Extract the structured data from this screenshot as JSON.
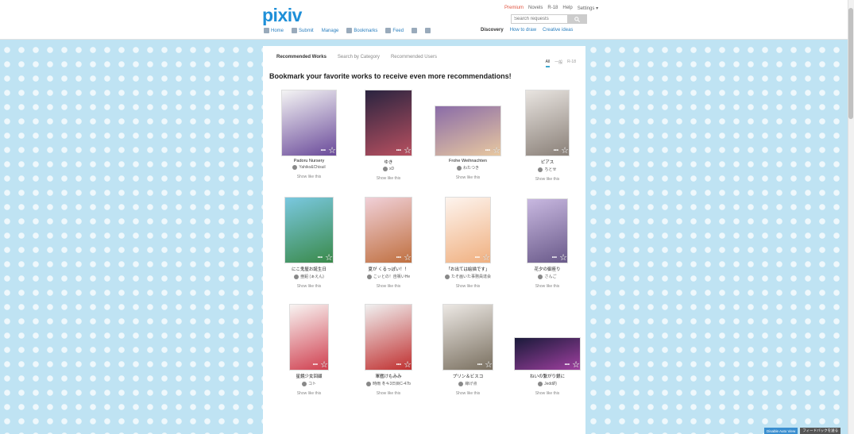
{
  "header": {
    "logo": "pixiv",
    "top_links": [
      "Premium",
      "Novels",
      "R-18",
      "Help",
      "Settings ▾"
    ],
    "search_placeholder": "Search requests",
    "nav": [
      "Home",
      "Submit",
      "Manage",
      "Bookmarks",
      "Feed"
    ],
    "nav_right": [
      "Discovery",
      "How to draw",
      "Creative ideas"
    ]
  },
  "tabs": [
    "Recommended Works",
    "Search by Category",
    "Recommended Users"
  ],
  "filters": [
    "All",
    "一般",
    "R-18"
  ],
  "heading": "Bookmark your favorite works to receive even more recommendations!",
  "more_label": "Show like this",
  "works": [
    {
      "title": "Padoru Nursery",
      "author": "Yahiko&Chisuil",
      "colors": [
        "#f4f4f4",
        "#6a4a9a"
      ]
    },
    {
      "title": "ゆき",
      "author": "xD",
      "colors": [
        "#2a2440",
        "#b85060"
      ]
    },
    {
      "title": "Frohe Weihnachten",
      "author": "わたつき",
      "colors": [
        "#8a6ca8",
        "#e8c8a0"
      ]
    },
    {
      "title": "ピアス",
      "author": "ちとせ",
      "colors": [
        "#e8e4e0",
        "#8a8078"
      ]
    },
    {
      "title": "にこ鬼屋お誕生日",
      "author": "亜鉛 (ぁえん)",
      "colors": [
        "#7ac8e0",
        "#3a8a4a"
      ]
    },
    {
      "title": "夏が くるっぽい！！",
      "author": "こぃとの！自販いHe",
      "colors": [
        "#f0d0d8",
        "#c07040"
      ]
    },
    {
      "title": "「お出ては絵描です」",
      "author": "たそ画いた事務員達会",
      "colors": [
        "#fdf4ee",
        "#f0b080"
      ]
    },
    {
      "title": "花夕の御座り",
      "author": "さんご",
      "colors": [
        "#c8b8e0",
        "#6a5a8a"
      ]
    },
    {
      "title": "星鏡少女回顧",
      "author": "コト",
      "colors": [
        "#f8f4f2",
        "#d04050"
      ]
    },
    {
      "title": "軍艦けもみみ",
      "author": "時雨 冬キ3日目C-47b",
      "colors": [
        "#f0f0f0",
        "#c03030"
      ]
    },
    {
      "title": "プリン＆ビスコ",
      "author": "線げ点",
      "colors": [
        "#ece8e4",
        "#7a7060"
      ]
    },
    {
      "title": "ねいの繋がり銀に",
      "author": "Jedd的",
      "colors": [
        "#1a1a3a",
        "#a040a0"
      ]
    }
  ],
  "bottom_buttons": [
    "Disable Auto View",
    "フィードバックを送る"
  ]
}
